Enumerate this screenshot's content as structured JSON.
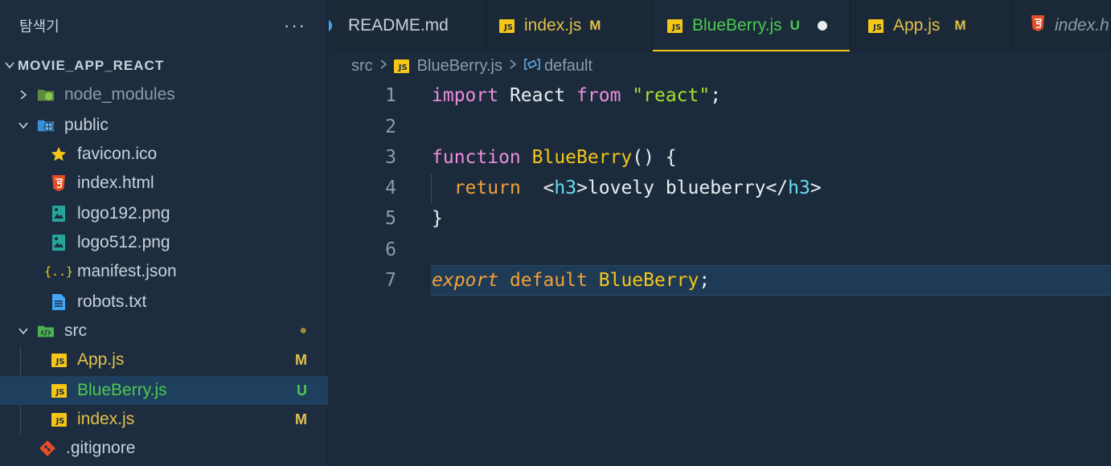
{
  "colors": {
    "js_yellow": "#f5c518",
    "untracked_green": "#4ec94e",
    "modified_yellow": "#e2c04a",
    "html_orange": "#e44d26",
    "selection_blue": "#1f3f5e"
  },
  "sidebar": {
    "title": "탐색기",
    "more": "···",
    "project": "MOVIE_APP_REACT",
    "items": [
      {
        "label": "node_modules",
        "icon": "node-modules-folder-icon",
        "badge": ""
      },
      {
        "label": "public",
        "icon": "public-folder-icon",
        "badge": ""
      },
      {
        "label": "favicon.ico",
        "icon": "star-icon",
        "badge": ""
      },
      {
        "label": "index.html",
        "icon": "html5-icon",
        "badge": ""
      },
      {
        "label": "logo192.png",
        "icon": "image-file-icon",
        "badge": ""
      },
      {
        "label": "logo512.png",
        "icon": "image-file-icon",
        "badge": ""
      },
      {
        "label": "manifest.json",
        "icon": "json-braces-icon",
        "badge": ""
      },
      {
        "label": "robots.txt",
        "icon": "text-file-icon",
        "badge": ""
      },
      {
        "label": "src",
        "icon": "src-folder-icon",
        "badge": "●"
      },
      {
        "label": "App.js",
        "icon": "js-file-icon",
        "badge": "M"
      },
      {
        "label": "BlueBerry.js",
        "icon": "js-file-icon",
        "badge": "U"
      },
      {
        "label": "index.js",
        "icon": "js-file-icon",
        "badge": "M"
      },
      {
        "label": ".gitignore",
        "icon": "git-icon",
        "badge": ""
      }
    ]
  },
  "tabs": [
    {
      "label": "README.md",
      "status": "",
      "icon": "info-icon"
    },
    {
      "label": "index.js",
      "status": "M",
      "icon": "js-file-icon"
    },
    {
      "label": "BlueBerry.js",
      "status": "U",
      "icon": "js-file-icon"
    },
    {
      "label": "App.js",
      "status": "M",
      "icon": "js-file-icon"
    },
    {
      "label": "index.h",
      "status": "",
      "icon": "html5-icon"
    }
  ],
  "breadcrumb": {
    "folder": "src",
    "file": "BlueBerry.js",
    "symbol": "default"
  },
  "editor": {
    "line_numbers": [
      "1",
      "2",
      "3",
      "4",
      "5",
      "6",
      "7"
    ],
    "code": {
      "l1_import": "import",
      "l1_react": " React ",
      "l1_from": "from",
      "l1_space": " ",
      "l1_str": "\"react\"",
      "l1_semi": ";",
      "l3_function": "function",
      "l3_space": " ",
      "l3_name": "BlueBerry",
      "l3_rest": "() {",
      "l4_indent": "  ",
      "l4_return": "return",
      "l4_space": "  ",
      "l4_lt": "<",
      "l4_tag1": "h3",
      "l4_text": ">lovely blueberry</",
      "l4_tag2": "h3",
      "l4_gt": ">",
      "l5_brace": "}",
      "l7_export": "export",
      "l7_space": " ",
      "l7_default": "default",
      "l7_space2": " ",
      "l7_name": "BlueBerry",
      "l7_semi": ";"
    }
  }
}
